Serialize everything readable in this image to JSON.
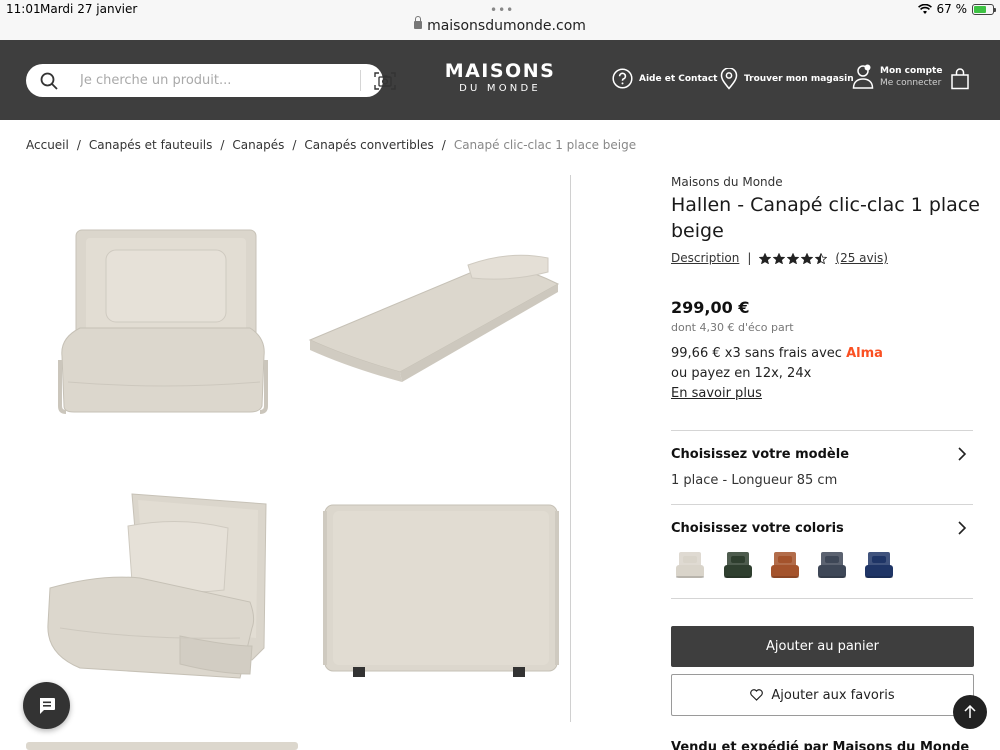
{
  "status_bar": {
    "time": "11:01",
    "date": "Mardi 27 janvier",
    "url": "maisonsdumonde.com",
    "battery": "67 %",
    "battery_level": 0.67
  },
  "header": {
    "search_placeholder": "Je cherche un produit...",
    "logo_main": "MAISONS",
    "logo_sub": "DU MONDE",
    "help_label": "Aide et Contact",
    "store_label": "Trouver mon magasin",
    "account_title": "Mon compte",
    "account_subtitle": "Me connecter"
  },
  "breadcrumb": {
    "items": [
      "Accueil",
      "Canapés et fauteuils",
      "Canapés",
      "Canapés convertibles"
    ],
    "current": "Canapé clic-clac 1 place beige"
  },
  "product": {
    "brand": "Maisons du Monde",
    "title": "Hallen - Canapé clic-clac 1 place beige",
    "description_link": "Description",
    "rating": 4.5,
    "rating_max": 5,
    "reviews": "(25 avis)",
    "price": "299,00 €",
    "eco_part": "dont 4,30 € d'éco part",
    "installment_text": "99,66 € x3 sans frais avec",
    "alma": "Alma",
    "installment_more": "ou payez en 12x, 24x",
    "learn_more": "En savoir plus",
    "model_heading": "Choisissez votre modèle",
    "model_value": "1 place - Longueur 85 cm",
    "color_heading": "Choisissez votre coloris",
    "swatches": [
      {
        "name": "beige",
        "color": "#d9d4ca"
      },
      {
        "name": "green",
        "color": "#2f3f2f"
      },
      {
        "name": "terracotta",
        "color": "#a4532c"
      },
      {
        "name": "slate",
        "color": "#3e4757"
      },
      {
        "name": "navy",
        "color": "#1f3566"
      }
    ],
    "add_to_cart": "Ajouter au panier",
    "add_to_favorites": "Ajouter aux favoris",
    "next_section": "Vendu et expédié par Maisons du Monde"
  },
  "colors": {
    "header_bg": "#3e3e3e",
    "accent_alma": "#fa5022",
    "fabric": "#dcd7cd"
  }
}
